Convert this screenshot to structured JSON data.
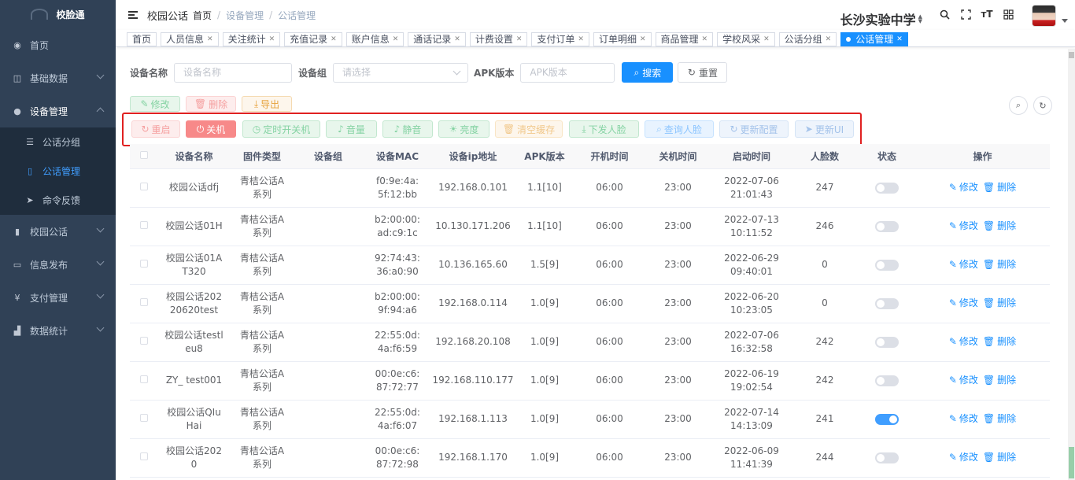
{
  "sidebar": {
    "logo": "校脸通",
    "items": [
      {
        "icon": "dashboard-icon",
        "label": "首页"
      },
      {
        "icon": "table-icon",
        "label": "基础数据"
      },
      {
        "icon": "globe-icon",
        "label": "设备管理"
      },
      {
        "icon": "phone-icon",
        "label": "校园公话"
      },
      {
        "icon": "monitor-icon",
        "label": "信息发布"
      },
      {
        "icon": "yen-icon",
        "label": "支付管理"
      },
      {
        "icon": "bar-chart-icon",
        "label": "数据统计"
      }
    ],
    "sub": [
      {
        "icon": "list-icon",
        "label": "公话分组"
      },
      {
        "icon": "phone-icon",
        "label": "公话管理"
      },
      {
        "icon": "send-icon",
        "label": "命令反馈"
      }
    ]
  },
  "navbar": {
    "breadcrumb_root": "校园公话",
    "breadcrumb": [
      "首页",
      "设备管理",
      "公话管理"
    ],
    "school": "长沙实验中学"
  },
  "tags": [
    "首页",
    "人员信息",
    "关注统计",
    "充值记录",
    "账户信息",
    "通话记录",
    "计费设置",
    "支付订单",
    "订单明细",
    "商品管理",
    "学校风采",
    "公话分组",
    "公话管理"
  ],
  "search": {
    "name_label": "设备名称",
    "name_placeholder": "设备名称",
    "group_label": "设备组",
    "group_placeholder": "请选择",
    "apk_label": "APK版本",
    "apk_placeholder": "APK版本",
    "search_btn": "搜索",
    "reset_btn": "重置"
  },
  "toolbar": {
    "edit": "修改",
    "delete": "删除",
    "export": "导出",
    "restart": "重启",
    "shutdown": "关机",
    "timer": "定时开关机",
    "volume": "音量",
    "mute": "静音",
    "brightness": "亮度",
    "clear_cache": "清空缓存",
    "push_face": "下发人脸",
    "query_face": "查询人脸",
    "update_config": "更新配置",
    "update_ui": "更新UI"
  },
  "table": {
    "headers": [
      "设备名称",
      "固件类型",
      "设备组",
      "设备MAC",
      "设备ip地址",
      "APK版本",
      "开机时间",
      "关机时间",
      "启动时间",
      "人脸数",
      "状态",
      "操作"
    ],
    "op_edit": "修改",
    "op_delete": "删除",
    "rows": [
      {
        "name": "校园公话dfj",
        "fw": "青桔公话A系列",
        "group": "",
        "mac": "f0:9e:4a:5f:12:bb",
        "ip": "192.168.0.101",
        "apk": "1.1[10]",
        "on": "06:00",
        "off": "23:00",
        "start": "2022-07-06 21:01:43",
        "faces": "247",
        "status": false
      },
      {
        "name": "校园公话01H",
        "fw": "青桔公话A系列",
        "group": "",
        "mac": "b2:00:00:ad:c9:1c",
        "ip": "10.130.171.206",
        "apk": "1.1[10]",
        "on": "06:00",
        "off": "23:00",
        "start": "2022-07-13 10:11:52",
        "faces": "246",
        "status": false
      },
      {
        "name": "校园公话01AT320",
        "fw": "青桔公话A系列",
        "group": "",
        "mac": "92:74:43:36:a0:90",
        "ip": "10.136.165.60",
        "apk": "1.5[9]",
        "on": "06:00",
        "off": "23:00",
        "start": "2022-06-29 09:40:01",
        "faces": "0",
        "status": false
      },
      {
        "name": "校园公话20220620test",
        "fw": "青桔公话A系列",
        "group": "",
        "mac": "b2:00:00:9f:94:a6",
        "ip": "192.168.0.114",
        "apk": "1.0[9]",
        "on": "06:00",
        "off": "23:00",
        "start": "2022-06-20 10:23:05",
        "faces": "0",
        "status": false
      },
      {
        "name": "校园公话testleu8",
        "fw": "青桔公话A系列",
        "group": "",
        "mac": "22:55:0d:4a:f6:59",
        "ip": "192.168.20.108",
        "apk": "1.0[9]",
        "on": "06:00",
        "off": "23:00",
        "start": "2022-07-06 16:32:58",
        "faces": "242",
        "status": false
      },
      {
        "name": "ZY_ test001",
        "fw": "青桔公话A系列",
        "group": "",
        "mac": "00:0e:c6:87:72:77",
        "ip": "192.168.110.177",
        "apk": "1.0[9]",
        "on": "06:00",
        "off": "23:00",
        "start": "2022-06-19 19:02:54",
        "faces": "242",
        "status": false
      },
      {
        "name": "校园公话QIuHai",
        "fw": "青桔公话A系列",
        "group": "",
        "mac": "22:55:0d:4a:f6:07",
        "ip": "192.168.1.113",
        "apk": "1.0[9]",
        "on": "06:00",
        "off": "23:00",
        "start": "2022-07-14 14:13:09",
        "faces": "241",
        "status": true
      },
      {
        "name": "校园公话2020",
        "fw": "青桔公话A系列",
        "group": "",
        "mac": "00:0e:c6:87:72:98",
        "ip": "192.168.1.170",
        "apk": "1.0[9]",
        "on": "06:00",
        "off": "23:00",
        "start": "2022-06-09 11:41:39",
        "faces": "244",
        "status": false
      }
    ]
  }
}
